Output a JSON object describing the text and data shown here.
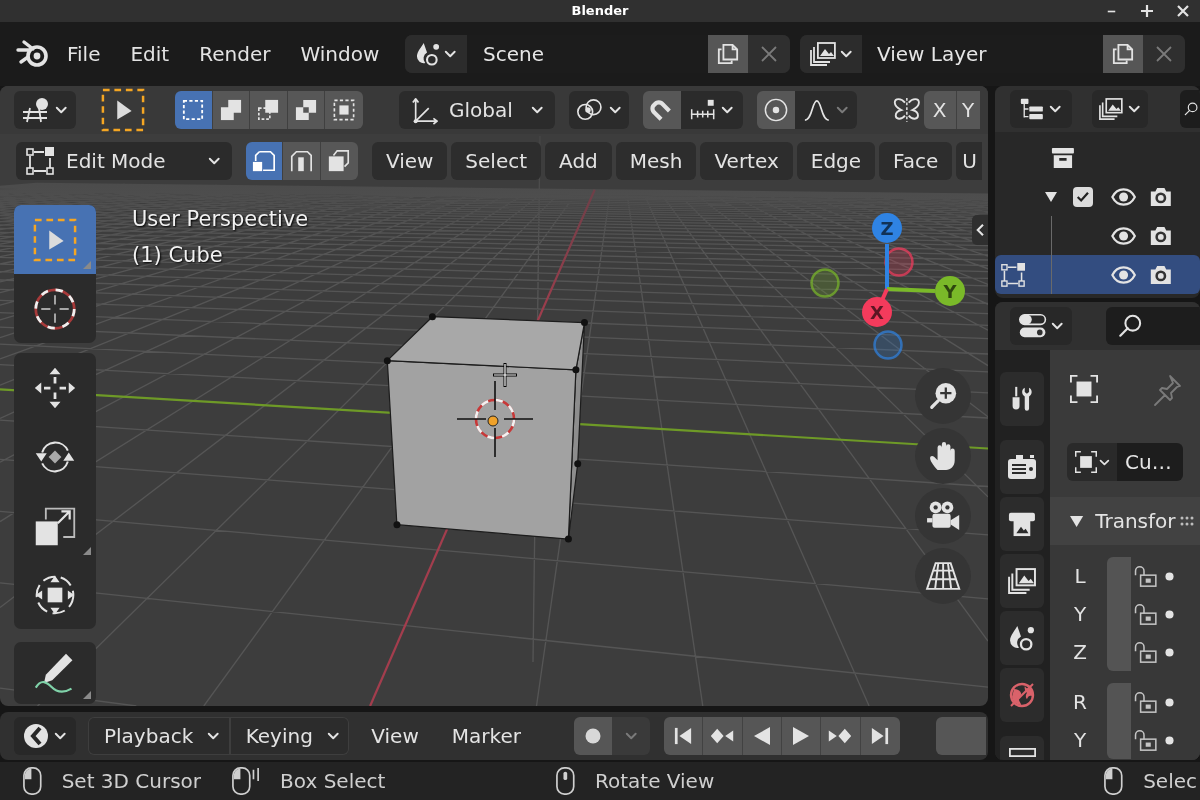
{
  "window": {
    "title": "Blender"
  },
  "topbar": {
    "menus": [
      {
        "label": "File"
      },
      {
        "label": "Edit"
      },
      {
        "label": "Render"
      },
      {
        "label": "Window"
      }
    ],
    "scene": {
      "value": "Scene"
    },
    "view_layer": {
      "value": "View Layer"
    }
  },
  "viewport": {
    "tool_header": {
      "select_modes": [
        {
          "kind": "set",
          "selected": true
        },
        {
          "kind": "extend",
          "selected": false
        },
        {
          "kind": "subtract",
          "selected": false
        },
        {
          "kind": "difference",
          "selected": false
        },
        {
          "kind": "intersect",
          "selected": false
        }
      ],
      "orientation": "Global",
      "snap": {
        "on": false
      },
      "proportional": {
        "on": false
      },
      "mirror": [
        {
          "label": "X",
          "on": false
        },
        {
          "label": "Y",
          "on": false
        }
      ]
    },
    "header": {
      "mode": "Edit Mode",
      "mesh_select_modes": [
        {
          "kind": "vertex",
          "selected": true
        },
        {
          "kind": "edge",
          "selected": false
        },
        {
          "kind": "face",
          "selected": false
        }
      ],
      "menus": [
        {
          "label": "View"
        },
        {
          "label": "Select"
        },
        {
          "label": "Add"
        },
        {
          "label": "Mesh"
        },
        {
          "label": "Vertex"
        },
        {
          "label": "Edge"
        },
        {
          "label": "Face"
        },
        {
          "label": "U"
        }
      ]
    },
    "toolbar": [
      [
        {
          "kind": "select_box",
          "selected": true,
          "flyout": true
        },
        {
          "kind": "cursor",
          "selected": false,
          "flyout": false
        }
      ],
      [
        {
          "kind": "move",
          "selected": false,
          "flyout": false
        },
        {
          "kind": "rotate",
          "selected": false,
          "flyout": false
        },
        {
          "kind": "scale",
          "selected": false,
          "flyout": true
        },
        {
          "kind": "transform",
          "selected": false,
          "flyout": false
        }
      ],
      [
        {
          "kind": "annotate",
          "selected": false,
          "flyout": true
        }
      ]
    ],
    "overlay": [
      "User Perspective",
      "(1) Cube"
    ],
    "gizmo": {
      "axes": [
        {
          "label": "Z",
          "color": "#2f83e3"
        },
        {
          "label": "Y",
          "color": "#7ab929"
        },
        {
          "label": "X",
          "color": "#f43b5c"
        }
      ]
    }
  },
  "timeline": {
    "menus": [
      {
        "label": "Playback",
        "kind": "dropdown"
      },
      {
        "label": "Keying",
        "kind": "dropdown"
      },
      {
        "label": "View",
        "kind": "menu"
      },
      {
        "label": "Marker",
        "kind": "menu"
      }
    ],
    "auto_keying": {
      "on": false
    }
  },
  "outliner": {
    "tree": [
      {
        "kind": "scene_collection",
        "selected": false,
        "children": [
          {
            "kind": "collection",
            "selected": false,
            "expanded": true,
            "checked": true,
            "children": [
              {
                "kind": "object",
                "selected": false
              },
              {
                "kind": "mesh",
                "selected": true
              }
            ]
          }
        ]
      }
    ]
  },
  "properties": {
    "tabs": [
      [
        {
          "kind": "tool",
          "selected": false
        }
      ],
      [
        {
          "kind": "render",
          "selected": false
        },
        {
          "kind": "output",
          "selected": false
        },
        {
          "kind": "view_layer",
          "selected": false
        },
        {
          "kind": "scene",
          "selected": false
        },
        {
          "kind": "world",
          "selected": false
        }
      ],
      [
        {
          "kind": "collection",
          "selected": false
        }
      ]
    ],
    "object_name": "Cu…",
    "panel": {
      "title": "Transfor",
      "expanded": true,
      "groups": [
        [
          {
            "label": "L",
            "locked": false
          },
          {
            "label": "Y",
            "locked": false
          },
          {
            "label": "Z",
            "locked": false
          }
        ],
        [
          {
            "label": "R",
            "locked": false
          },
          {
            "label": "Y",
            "locked": false
          }
        ]
      ]
    }
  },
  "status_bar": {
    "hints": [
      {
        "label": "Set 3D Cursor",
        "kind": "left_click"
      },
      {
        "label": "Box Select",
        "kind": "left_drag"
      },
      {
        "label": "Rotate View",
        "kind": "middle_click"
      },
      {
        "label": "Selec",
        "kind": "left_click"
      }
    ]
  }
}
